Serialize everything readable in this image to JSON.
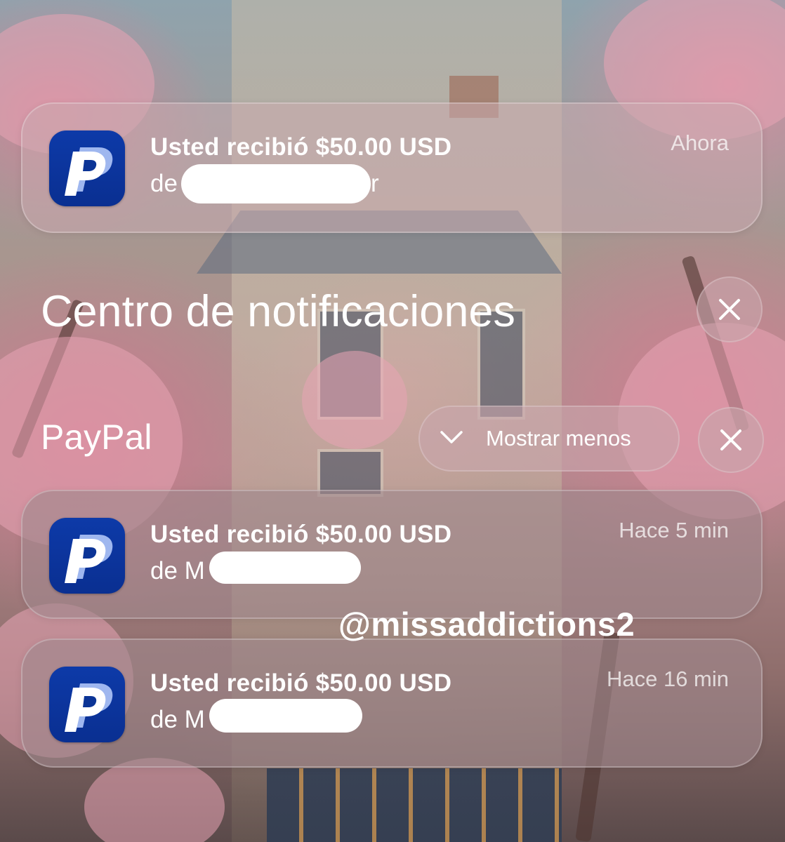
{
  "top_notification": {
    "app_icon": "paypal-icon",
    "title": "Usted recibió $50.00 USD",
    "body_prefix": "de",
    "body_suffix": "r",
    "time": "Ahora"
  },
  "header": {
    "title": "Centro de notificaciones",
    "close_icon": "close-icon"
  },
  "group": {
    "name": "PayPal",
    "show_less_label": "Mostrar menos",
    "chevron_icon": "chevron-down-icon",
    "close_icon": "close-icon",
    "notifications": [
      {
        "app_icon": "paypal-icon",
        "title": "Usted recibió $50.00 USD",
        "body_prefix": "de M",
        "time": "Hace 5 min"
      },
      {
        "app_icon": "paypal-icon",
        "title": "Usted recibió $50.00 USD",
        "body_prefix": "de M",
        "time": "Hace 16 min"
      }
    ]
  },
  "watermark": "@missaddictions2",
  "colors": {
    "paypal_blue": "#0a2f91",
    "paypal_light": "#d6e4ff",
    "text": "#ffffff"
  }
}
